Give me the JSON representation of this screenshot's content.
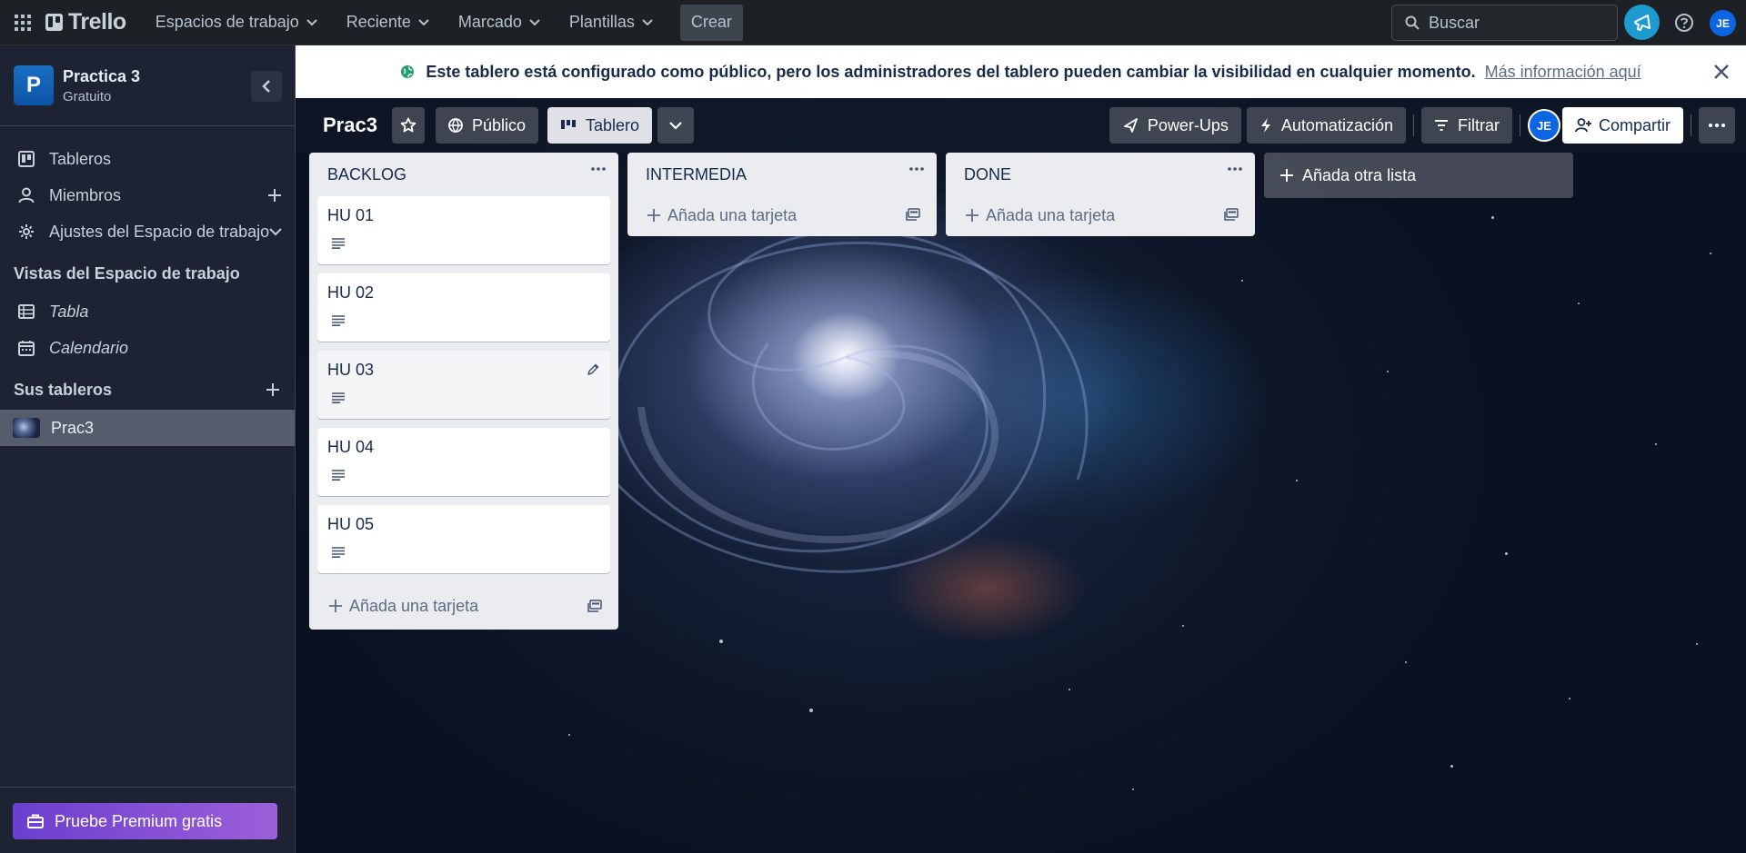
{
  "topbar": {
    "logo": "Trello",
    "nav": [
      "Espacios de trabajo",
      "Reciente",
      "Marcado",
      "Plantillas"
    ],
    "create": "Crear",
    "search_placeholder": "Buscar",
    "avatar": "JE"
  },
  "sidebar": {
    "workspace_initial": "P",
    "workspace_name": "Practica 3",
    "workspace_plan": "Gratuito",
    "items": [
      {
        "label": "Tableros",
        "icon": "board-icon"
      },
      {
        "label": "Miembros",
        "icon": "person-icon"
      },
      {
        "label": "Ajustes del Espacio de trabajo",
        "icon": "gear-icon"
      }
    ],
    "views_title": "Vistas del Espacio de trabajo",
    "views": [
      {
        "label": "Tabla",
        "icon": "table-icon"
      },
      {
        "label": "Calendario",
        "icon": "calendar-icon"
      }
    ],
    "boards_title": "Sus tableros",
    "boards": [
      "Prac3"
    ],
    "premium": "Pruebe Premium gratis"
  },
  "banner": {
    "message": "Este tablero está configurado como público, pero los administradores del tablero pueden cambiar la visibilidad en cualquier momento.",
    "link": "Más información aquí"
  },
  "board": {
    "title": "Prac3",
    "visibility": "Público",
    "view": "Tablero",
    "powerups": "Power-Ups",
    "automation": "Automatización",
    "filter": "Filtrar",
    "avatar": "JE",
    "share": "Compartir",
    "lists": [
      {
        "title": "BACKLOG",
        "cards": [
          "HU 01",
          "HU 02",
          "HU 03",
          "HU 04",
          "HU 05"
        ],
        "add": "Añada una tarjeta"
      },
      {
        "title": "INTERMEDIA",
        "cards": [],
        "add": "Añada una tarjeta"
      },
      {
        "title": "DONE",
        "cards": [],
        "add": "Añada una tarjeta"
      }
    ],
    "add_list": "Añada otra lista"
  },
  "colors": {
    "topbar": "#1d2125",
    "sidebar": "#1d2333",
    "list_bg": "#ebecf0",
    "premium": "#8f56d7",
    "avatar": "#0c66e4"
  }
}
